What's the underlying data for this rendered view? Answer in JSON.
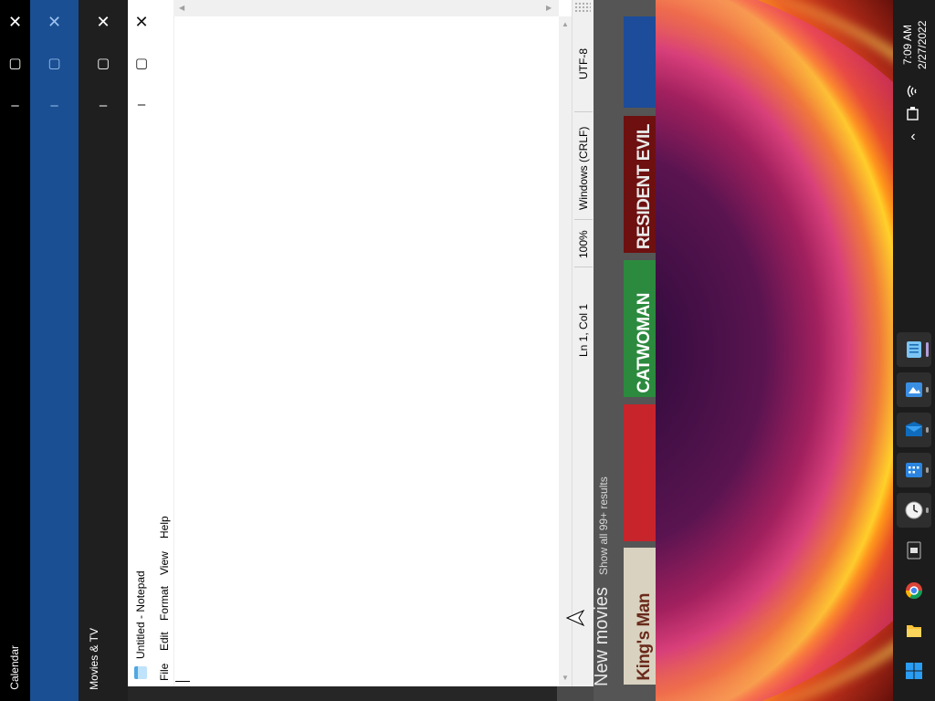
{
  "windows": {
    "calendar": {
      "title": "Calendar"
    },
    "blue_window": {
      "title": ""
    },
    "movies_tv": {
      "title": "Movies & TV"
    }
  },
  "movies": {
    "section_title": "New movies",
    "show_all": "Show all 99+ results",
    "posters": [
      {
        "title": "King's Man",
        "color": "#d9d2c0",
        "text_color": "#6a2a1a"
      },
      {
        "title": "",
        "color": "#c8242c",
        "text_color": "#ffffff"
      },
      {
        "title": "CATWOMAN",
        "color": "#2c8a3e",
        "text_color": "#ffffff"
      },
      {
        "title": "RESIDENT EVIL",
        "color": "#6e1010",
        "text_color": "#eaeaea"
      },
      {
        "title": "",
        "color": "#1d4c9a",
        "text_color": "#ffffff"
      }
    ]
  },
  "notepad": {
    "title": "Untitled - Notepad",
    "menus": [
      "File",
      "Edit",
      "Format",
      "View",
      "Help"
    ],
    "status": {
      "position": "Ln 1, Col 1",
      "zoom": "100%",
      "line_endings": "Windows (CRLF)",
      "encoding": "UTF-8"
    },
    "icons": {
      "close": "close-icon",
      "maximize": "maximize-icon",
      "minimize": "minimize-icon"
    }
  },
  "taskbar": {
    "time": "7:09 AM",
    "date": "2/27/2022",
    "apps": [
      {
        "name": "notepad",
        "icon": "notepad-icon",
        "active": true
      },
      {
        "name": "photos",
        "icon": "photos-icon",
        "active": true
      },
      {
        "name": "mail",
        "icon": "mail-icon",
        "active": true
      },
      {
        "name": "calendar",
        "icon": "calendar-icon",
        "active": true
      },
      {
        "name": "clock",
        "icon": "clock-icon",
        "active": true
      },
      {
        "name": "movies-tv",
        "icon": "movies-tv-icon",
        "active": false
      },
      {
        "name": "chrome",
        "icon": "chrome-icon",
        "active": false
      },
      {
        "name": "file-explorer",
        "icon": "file-explorer-icon",
        "active": false
      },
      {
        "name": "start",
        "icon": "windows-start-icon",
        "active": false
      }
    ],
    "colors": {
      "accent": "#b39ddb",
      "windows_blue": "#2a9df4"
    }
  }
}
